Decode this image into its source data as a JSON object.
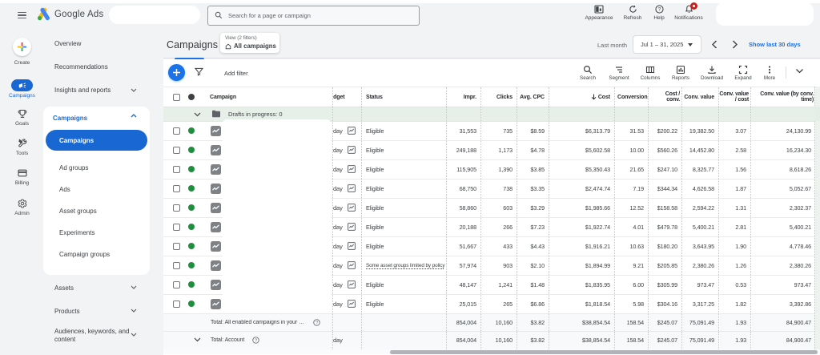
{
  "topbar": {
    "product": "Google Ads",
    "search_placeholder": "Search for a page or campaign",
    "items": [
      {
        "label": "Appearance",
        "icon": "appearance-icon"
      },
      {
        "label": "Refresh",
        "icon": "refresh-icon"
      },
      {
        "label": "Help",
        "icon": "help-icon"
      },
      {
        "label": "Notifications",
        "icon": "notifications-bell-icon",
        "badge": true
      }
    ]
  },
  "rail": {
    "items": [
      {
        "label": "Create",
        "icon": "plus-multicolor-icon"
      },
      {
        "label": "Campaigns",
        "icon": "megaphone-icon",
        "selected": true
      },
      {
        "label": "Goals",
        "icon": "trophy-icon"
      },
      {
        "label": "Tools",
        "icon": "wrench-icon"
      },
      {
        "label": "Billing",
        "icon": "credit-card-icon"
      },
      {
        "label": "Admin",
        "icon": "gear-icon"
      }
    ]
  },
  "sidebar": {
    "top_items": [
      {
        "label": "Overview"
      },
      {
        "label": "Recommendations"
      },
      {
        "label": "Insights and reports",
        "chevron": "down"
      }
    ],
    "section": {
      "label": "Campaigns",
      "chevron": "up",
      "items": [
        {
          "label": "Campaigns",
          "selected": true
        },
        {
          "label": "Ad groups"
        },
        {
          "label": "Ads"
        },
        {
          "label": "Asset groups"
        },
        {
          "label": "Experiments"
        },
        {
          "label": "Campaign groups"
        }
      ]
    },
    "bottom_items": [
      {
        "label": "Assets",
        "chevron": "down"
      },
      {
        "label": "Products",
        "chevron": "down"
      },
      {
        "label": "Audiences, keywords, and content",
        "chevron": "down"
      }
    ]
  },
  "page_header": {
    "title": "Campaigns",
    "view_chip": {
      "line1": "View (2 filters)",
      "line2": "All campaigns",
      "icon": "home-icon"
    },
    "date_range_label": "Last month",
    "date_range_value": "Jul 1 – 31, 2025",
    "prev_icon": "chevron-left-icon",
    "next_icon": "chevron-right-icon",
    "show_last_link": "Show last 30 days"
  },
  "toolbar": {
    "add_button": "+",
    "add_filter_label": "Add filter",
    "actions": [
      {
        "label": "Search",
        "icon": "search-icon"
      },
      {
        "label": "Segment",
        "icon": "segment-icon"
      },
      {
        "label": "Columns",
        "icon": "columns-icon"
      },
      {
        "label": "Reports",
        "icon": "reports-icon"
      },
      {
        "label": "Download",
        "icon": "download-icon"
      },
      {
        "label": "Expand",
        "icon": "expand-icon"
      },
      {
        "label": "More",
        "icon": "more-vertical-icon"
      }
    ],
    "collapse_icon": "chevron-down-icon"
  },
  "table": {
    "columns": {
      "campaign": "Campaign",
      "budget": "Budget",
      "status": "Status",
      "impr": "Impr.",
      "clicks": "Clicks",
      "avg_cpc": "Avg. CPC",
      "cost": "↓ Cost",
      "conversions": "Conversions",
      "cost_per_conv": "Cost /\nconv.",
      "conv_value": "Conv. value",
      "conv_value_per_cost": "Conv. value\n/ cost",
      "conv_value_by_time": "Conv. value (by conv.\ntime)"
    },
    "drafts_row": {
      "label": "Drafts in progress: 0",
      "icon": "folder-icon",
      "chevron": "down"
    },
    "row_icon": "performance-max-campaign-icon",
    "enabled_dot_icon": "enabled-status-dot",
    "budget_icon": "budget-report-icon",
    "help_icon": "help-circle-icon",
    "sort_icon": "sort-descending-icon",
    "budget_suffix": "/day",
    "rows": [
      {
        "status": "Eligible",
        "impr": "31,553",
        "clicks": "735",
        "avg_cpc": "$8.59",
        "cost": "$6,313.79",
        "conversions": "31.53",
        "cost_per_conv": "$200.22",
        "conv_value": "19,382.50",
        "conv_value_per_cost": "3.07",
        "conv_value_by_time": "24,130.99"
      },
      {
        "status": "Eligible",
        "impr": "249,188",
        "clicks": "1,173",
        "avg_cpc": "$4.78",
        "cost": "$5,602.58",
        "conversions": "10.00",
        "cost_per_conv": "$560.26",
        "conv_value": "14,452.80",
        "conv_value_per_cost": "2.58",
        "conv_value_by_time": "16,234.30"
      },
      {
        "status": "Eligible",
        "impr": "115,905",
        "clicks": "1,390",
        "avg_cpc": "$3.85",
        "cost": "$5,350.43",
        "conversions": "21.65",
        "cost_per_conv": "$247.10",
        "conv_value": "8,325.77",
        "conv_value_per_cost": "1.56",
        "conv_value_by_time": "8,618.26"
      },
      {
        "status": "Eligible",
        "impr": "68,750",
        "clicks": "738",
        "avg_cpc": "$3.35",
        "cost": "$2,474.74",
        "conversions": "7.19",
        "cost_per_conv": "$344.34",
        "conv_value": "4,626.58",
        "conv_value_per_cost": "1.87",
        "conv_value_by_time": "5,052.67"
      },
      {
        "status": "Eligible",
        "impr": "58,860",
        "clicks": "603",
        "avg_cpc": "$3.29",
        "cost": "$1,985.66",
        "conversions": "12.52",
        "cost_per_conv": "$158.58",
        "conv_value": "2,594.22",
        "conv_value_per_cost": "1.31",
        "conv_value_by_time": "2,302.37"
      },
      {
        "status": "Eligible",
        "impr": "20,188",
        "clicks": "266",
        "avg_cpc": "$7.23",
        "cost": "$1,922.74",
        "conversions": "4.01",
        "cost_per_conv": "$479.78",
        "conv_value": "5,400.21",
        "conv_value_per_cost": "2.81",
        "conv_value_by_time": "5,400.21"
      },
      {
        "status": "Eligible",
        "impr": "51,667",
        "clicks": "433",
        "avg_cpc": "$4.43",
        "cost": "$1,916.21",
        "conversions": "10.63",
        "cost_per_conv": "$180.20",
        "conv_value": "3,643.95",
        "conv_value_per_cost": "1.90",
        "conv_value_by_time": "4,778.46"
      },
      {
        "status": "Some asset groups limited by policy",
        "status_note": true,
        "impr": "57,974",
        "clicks": "903",
        "avg_cpc": "$2.10",
        "cost": "$1,894.99",
        "conversions": "9.21",
        "cost_per_conv": "$205.85",
        "conv_value": "2,380.26",
        "conv_value_per_cost": "1.26",
        "conv_value_by_time": "2,380.26"
      },
      {
        "status": "Eligible",
        "impr": "48,147",
        "clicks": "1,241",
        "avg_cpc": "$1.48",
        "cost": "$1,835.95",
        "conversions": "6.00",
        "cost_per_conv": "$305.99",
        "conv_value": "973.47",
        "conv_value_per_cost": "0.53",
        "conv_value_by_time": "973.47"
      },
      {
        "status": "Eligible",
        "impr": "25,015",
        "clicks": "265",
        "avg_cpc": "$6.86",
        "cost": "$1,818.54",
        "conversions": "5.98",
        "cost_per_conv": "$304.16",
        "conv_value": "3,317.25",
        "conv_value_per_cost": "1.82",
        "conv_value_by_time": "3,392.86"
      }
    ],
    "totals": [
      {
        "label": "Total: All enabled campaigns in your cur...",
        "help_icon": true,
        "impr": "854,004",
        "clicks": "10,160",
        "avg_cpc": "$3.82",
        "cost": "$38,854.54",
        "conversions": "158.54",
        "cost_per_conv": "$245.07",
        "conv_value": "75,091.49",
        "conv_value_per_cost": "1.93",
        "conv_value_by_time": "84,900.47"
      },
      {
        "label": "Total: Account",
        "help_icon": true,
        "chevron": "down",
        "budget": "/day",
        "impr": "854,004",
        "clicks": "10,160",
        "avg_cpc": "$3.82",
        "cost": "$38,854.54",
        "conversions": "158.54",
        "cost_per_conv": "$245.07",
        "conv_value": "75,091.49",
        "conv_value_per_cost": "1.93",
        "conv_value_by_time": "84,900.47"
      }
    ]
  },
  "colors": {
    "accent_blue": "#1a73e8",
    "nav_pill_blue": "#1967d2",
    "enabled_green": "#1e8e3e",
    "drafts_row_green": "#e6f0e9",
    "badge_red": "#c5221f",
    "logo_yellow": "#fbbc04",
    "logo_blue": "#4285f4",
    "logo_green": "#34a853"
  }
}
